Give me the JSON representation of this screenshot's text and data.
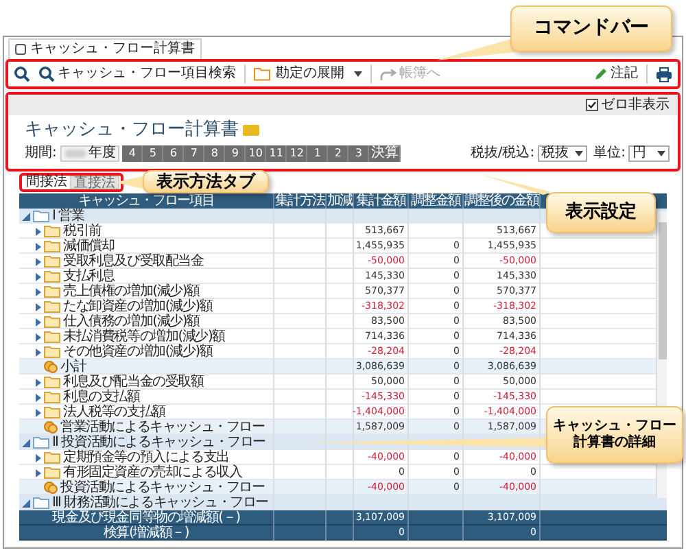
{
  "window": {
    "tab_title": "キャッシュ・フロー計算書"
  },
  "toolbar": {
    "search_label": "キャッシュ・フロー項目検索",
    "expand_label": "勘定の展開",
    "ledger": {
      "label": "帳簿へ",
      "disabled": true
    },
    "note_label": "注記"
  },
  "settings": {
    "zero_hide": {
      "label": "ゼロ非表示",
      "checked": true
    },
    "title": "キャッシュ・フロー計算書",
    "period_label": "期間:",
    "period_value": "年度",
    "months": [
      "4",
      "5",
      "6",
      "7",
      "8",
      "9",
      "10",
      "11",
      "12",
      "1",
      "2",
      "3",
      "決算"
    ],
    "tax": {
      "label": "税抜/税込:",
      "value": "税抜"
    },
    "unit": {
      "label": "単位:",
      "value": "円"
    }
  },
  "method_tabs": [
    {
      "label": "間接法",
      "selected": true
    },
    {
      "label": "直接法",
      "selected": false
    }
  ],
  "table": {
    "columns": [
      "キャッシュ・フロー項目",
      "集計方法",
      "加減",
      "集計金額",
      "調整金額",
      "調整後の金額"
    ],
    "sections": [
      {
        "label": "Ⅰ 営業",
        "expanded": true,
        "children": [
          {
            "kind": "item",
            "label": "税引前",
            "expanded": false,
            "total": "513,667",
            "adjusted": "513,667",
            "negative": false
          },
          {
            "kind": "item",
            "label": "減価償却",
            "expanded": false,
            "total": "1,455,935",
            "adjust": "0",
            "adjusted": "1,455,935",
            "negative": false
          },
          {
            "kind": "item",
            "label": "受取利息及び受取配当金",
            "expanded": false,
            "total": "-50,000",
            "adjust": "0",
            "adjusted": "-50,000",
            "negative": true
          },
          {
            "kind": "item",
            "label": "支払利息",
            "expanded": false,
            "total": "145,330",
            "adjust": "0",
            "adjusted": "145,330",
            "negative": false
          },
          {
            "kind": "item",
            "label": "売上債権の増加(減少)額",
            "expanded": false,
            "total": "570,377",
            "adjust": "0",
            "adjusted": "570,377",
            "negative": false
          },
          {
            "kind": "item",
            "label": "たな卸資産の増加(減少)額",
            "expanded": false,
            "total": "-318,302",
            "adjust": "0",
            "adjusted": "-318,302",
            "negative": true
          },
          {
            "kind": "item",
            "label": "仕入債務の増加(減少)額",
            "expanded": false,
            "total": "83,500",
            "adjust": "0",
            "adjusted": "83,500",
            "negative": false
          },
          {
            "kind": "item",
            "label": "未払消費税等の増加(減少)額",
            "expanded": false,
            "total": "714,336",
            "adjust": "0",
            "adjusted": "714,336",
            "negative": false
          },
          {
            "kind": "item",
            "label": "その他資産の増加(減少)額",
            "expanded": false,
            "total": "-28,204",
            "adjust": "0",
            "adjusted": "-28,204",
            "negative": true
          },
          {
            "kind": "subtotal",
            "label": "小計",
            "total": "3,086,639",
            "adjust": "0",
            "adjusted": "3,086,639",
            "negative": false
          },
          {
            "kind": "item",
            "label": "利息及び配当金の受取額",
            "expanded": false,
            "total": "50,000",
            "adjust": "0",
            "adjusted": "50,000",
            "negative": false
          },
          {
            "kind": "item",
            "label": "利息の支払額",
            "expanded": false,
            "total": "-145,330",
            "adjust": "0",
            "adjusted": "-145,330",
            "negative": true
          },
          {
            "kind": "item",
            "label": "法人税等の支払額",
            "expanded": false,
            "total": "-1,404,000",
            "adjust": "0",
            "adjusted": "-1,404,000",
            "negative": true
          },
          {
            "kind": "subtotal",
            "label": "営業活動によるキャッシュ・フロー",
            "total": "1,587,009",
            "adjust": "0",
            "adjusted": "1,587,009",
            "negative": false
          }
        ]
      },
      {
        "label": "Ⅱ 投資活動によるキャッシュ・フロー",
        "expanded": true,
        "children": [
          {
            "kind": "item",
            "label": "定期預金等の預入による支出",
            "expanded": false,
            "total": "-40,000",
            "adjust": "0",
            "adjusted": "-40,000",
            "negative": true
          },
          {
            "kind": "item",
            "label": "有形固定資産の売却による収入",
            "expanded": false,
            "total": "0",
            "adjust": "0",
            "adjusted": "0",
            "negative": false
          },
          {
            "kind": "subtotal",
            "label": "投資活動によるキャッシュ・フロー",
            "total": "-40,000",
            "adjust": "0",
            "adjusted": "-40,000",
            "negative": true
          }
        ]
      },
      {
        "label": "Ⅲ 財務活動によるキャッシュ・フロー",
        "expanded": true
      }
    ],
    "footer": [
      {
        "label": "現金及び現金同等物の増減額(－)",
        "total": "3,107,009",
        "adjusted": "3,107,009"
      },
      {
        "label": "検算(増減額－)",
        "total": "0",
        "adjusted": "0"
      }
    ]
  },
  "callouts": [
    {
      "text": "コマンドバー"
    },
    {
      "text": "表示方法タブ"
    },
    {
      "text": "表示設定"
    },
    {
      "text": "キャッシュ・フロー計算書の詳細"
    }
  ]
}
